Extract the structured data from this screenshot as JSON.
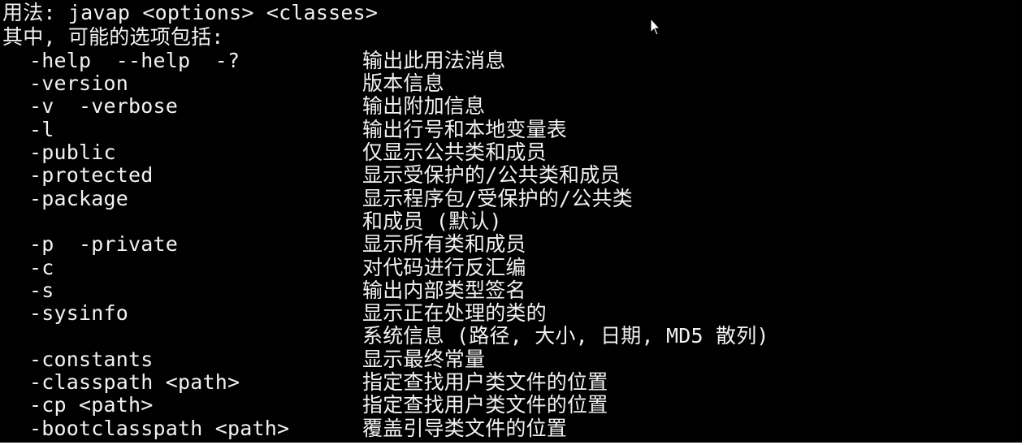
{
  "terminal": {
    "usage_line": "用法: javap <options> <classes>",
    "header_line": "其中, 可能的选项包括:",
    "rows": [
      {
        "option": "-help  --help  -?",
        "description": "输出此用法消息"
      },
      {
        "option": "-version",
        "description": "版本信息"
      },
      {
        "option": "-v  -verbose",
        "description": "输出附加信息"
      },
      {
        "option": "-l",
        "description": "输出行号和本地变量表"
      },
      {
        "option": "-public",
        "description": "仅显示公共类和成员"
      },
      {
        "option": "-protected",
        "description": "显示受保护的/公共类和成员"
      },
      {
        "option": "-package",
        "description": "显示程序包/受保护的/公共类"
      },
      {
        "option": "",
        "description": "和成员 (默认)"
      },
      {
        "option": "-p  -private",
        "description": "显示所有类和成员"
      },
      {
        "option": "-c",
        "description": "对代码进行反汇编"
      },
      {
        "option": "-s",
        "description": "输出内部类型签名"
      },
      {
        "option": "-sysinfo",
        "description": "显示正在处理的类的"
      },
      {
        "option": "",
        "description": "系统信息 (路径, 大小, 日期, MD5 散列)"
      },
      {
        "option": "-constants",
        "description": "显示最终常量"
      },
      {
        "option": "-classpath <path>",
        "description": "指定查找用户类文件的位置"
      },
      {
        "option": "-cp <path>",
        "description": "指定查找用户类文件的位置"
      },
      {
        "option": "-bootclasspath <path>",
        "description": "覆盖引导类文件的位置"
      }
    ]
  },
  "colors": {
    "background": "#000000",
    "text": "#f2f2f2"
  },
  "icons": {
    "cursor": "mouse-pointer-icon"
  }
}
